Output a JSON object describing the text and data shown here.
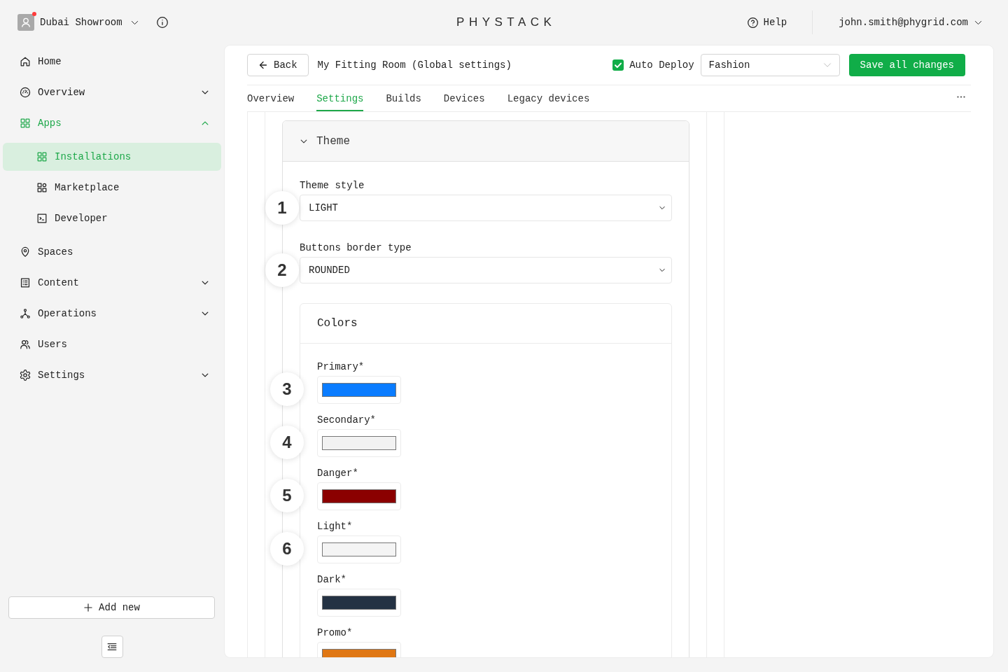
{
  "topbar": {
    "workspace": {
      "name": "Dubai Showroom",
      "notification": true
    },
    "logo": "PHYSTACK",
    "help": "Help",
    "account": "john.smith@phygrid.com"
  },
  "sidebar": {
    "items": [
      {
        "label": "Home",
        "selected": false
      },
      {
        "label": "Overview",
        "selected": false,
        "expanded": false
      },
      {
        "label": "Apps",
        "selected": true,
        "expanded": true,
        "children": [
          {
            "label": "Installations",
            "selected": true
          },
          {
            "label": "Marketplace",
            "selected": false
          },
          {
            "label": "Developer",
            "selected": false
          }
        ]
      },
      {
        "label": "Spaces",
        "selected": false
      },
      {
        "label": "Content",
        "selected": false,
        "expanded": false
      },
      {
        "label": "Operations",
        "selected": false,
        "expanded": false
      },
      {
        "label": "Users",
        "selected": false
      },
      {
        "label": "Settings",
        "selected": false,
        "expanded": false
      }
    ],
    "add_button": "Add new"
  },
  "toolbar": {
    "back": "Back",
    "title": "My Fitting Room (Global settings)",
    "auto_deploy": {
      "label": "Auto Deploy",
      "checked": true
    },
    "category": {
      "value": "Fashion"
    },
    "save": "Save all changes"
  },
  "tabs": [
    {
      "label": "Overview",
      "selected": false
    },
    {
      "label": "Settings",
      "selected": true
    },
    {
      "label": "Builds",
      "selected": false
    },
    {
      "label": "Devices",
      "selected": false
    },
    {
      "label": "Legacy devices",
      "selected": false
    }
  ],
  "theme": {
    "title": "Theme",
    "expanded": true,
    "fields": [
      {
        "label": "Theme style",
        "value": "LIGHT",
        "step": "1"
      },
      {
        "label": "Buttons border type",
        "value": "ROUNDED",
        "step": "2"
      }
    ],
    "colors": {
      "title": "Colors",
      "items": [
        {
          "label": "Primary*",
          "color": "#0a7cff",
          "step": "3"
        },
        {
          "label": "Secondary*",
          "color": "#f2f2f2",
          "step": "4"
        },
        {
          "label": "Danger*",
          "color": "#8b0000",
          "step": "5"
        },
        {
          "label": "Light*",
          "color": "#f4f4f4",
          "step": "6"
        },
        {
          "label": "Dark*",
          "color": "#243243"
        },
        {
          "label": "Promo*",
          "color": "#e07714"
        }
      ]
    }
  }
}
